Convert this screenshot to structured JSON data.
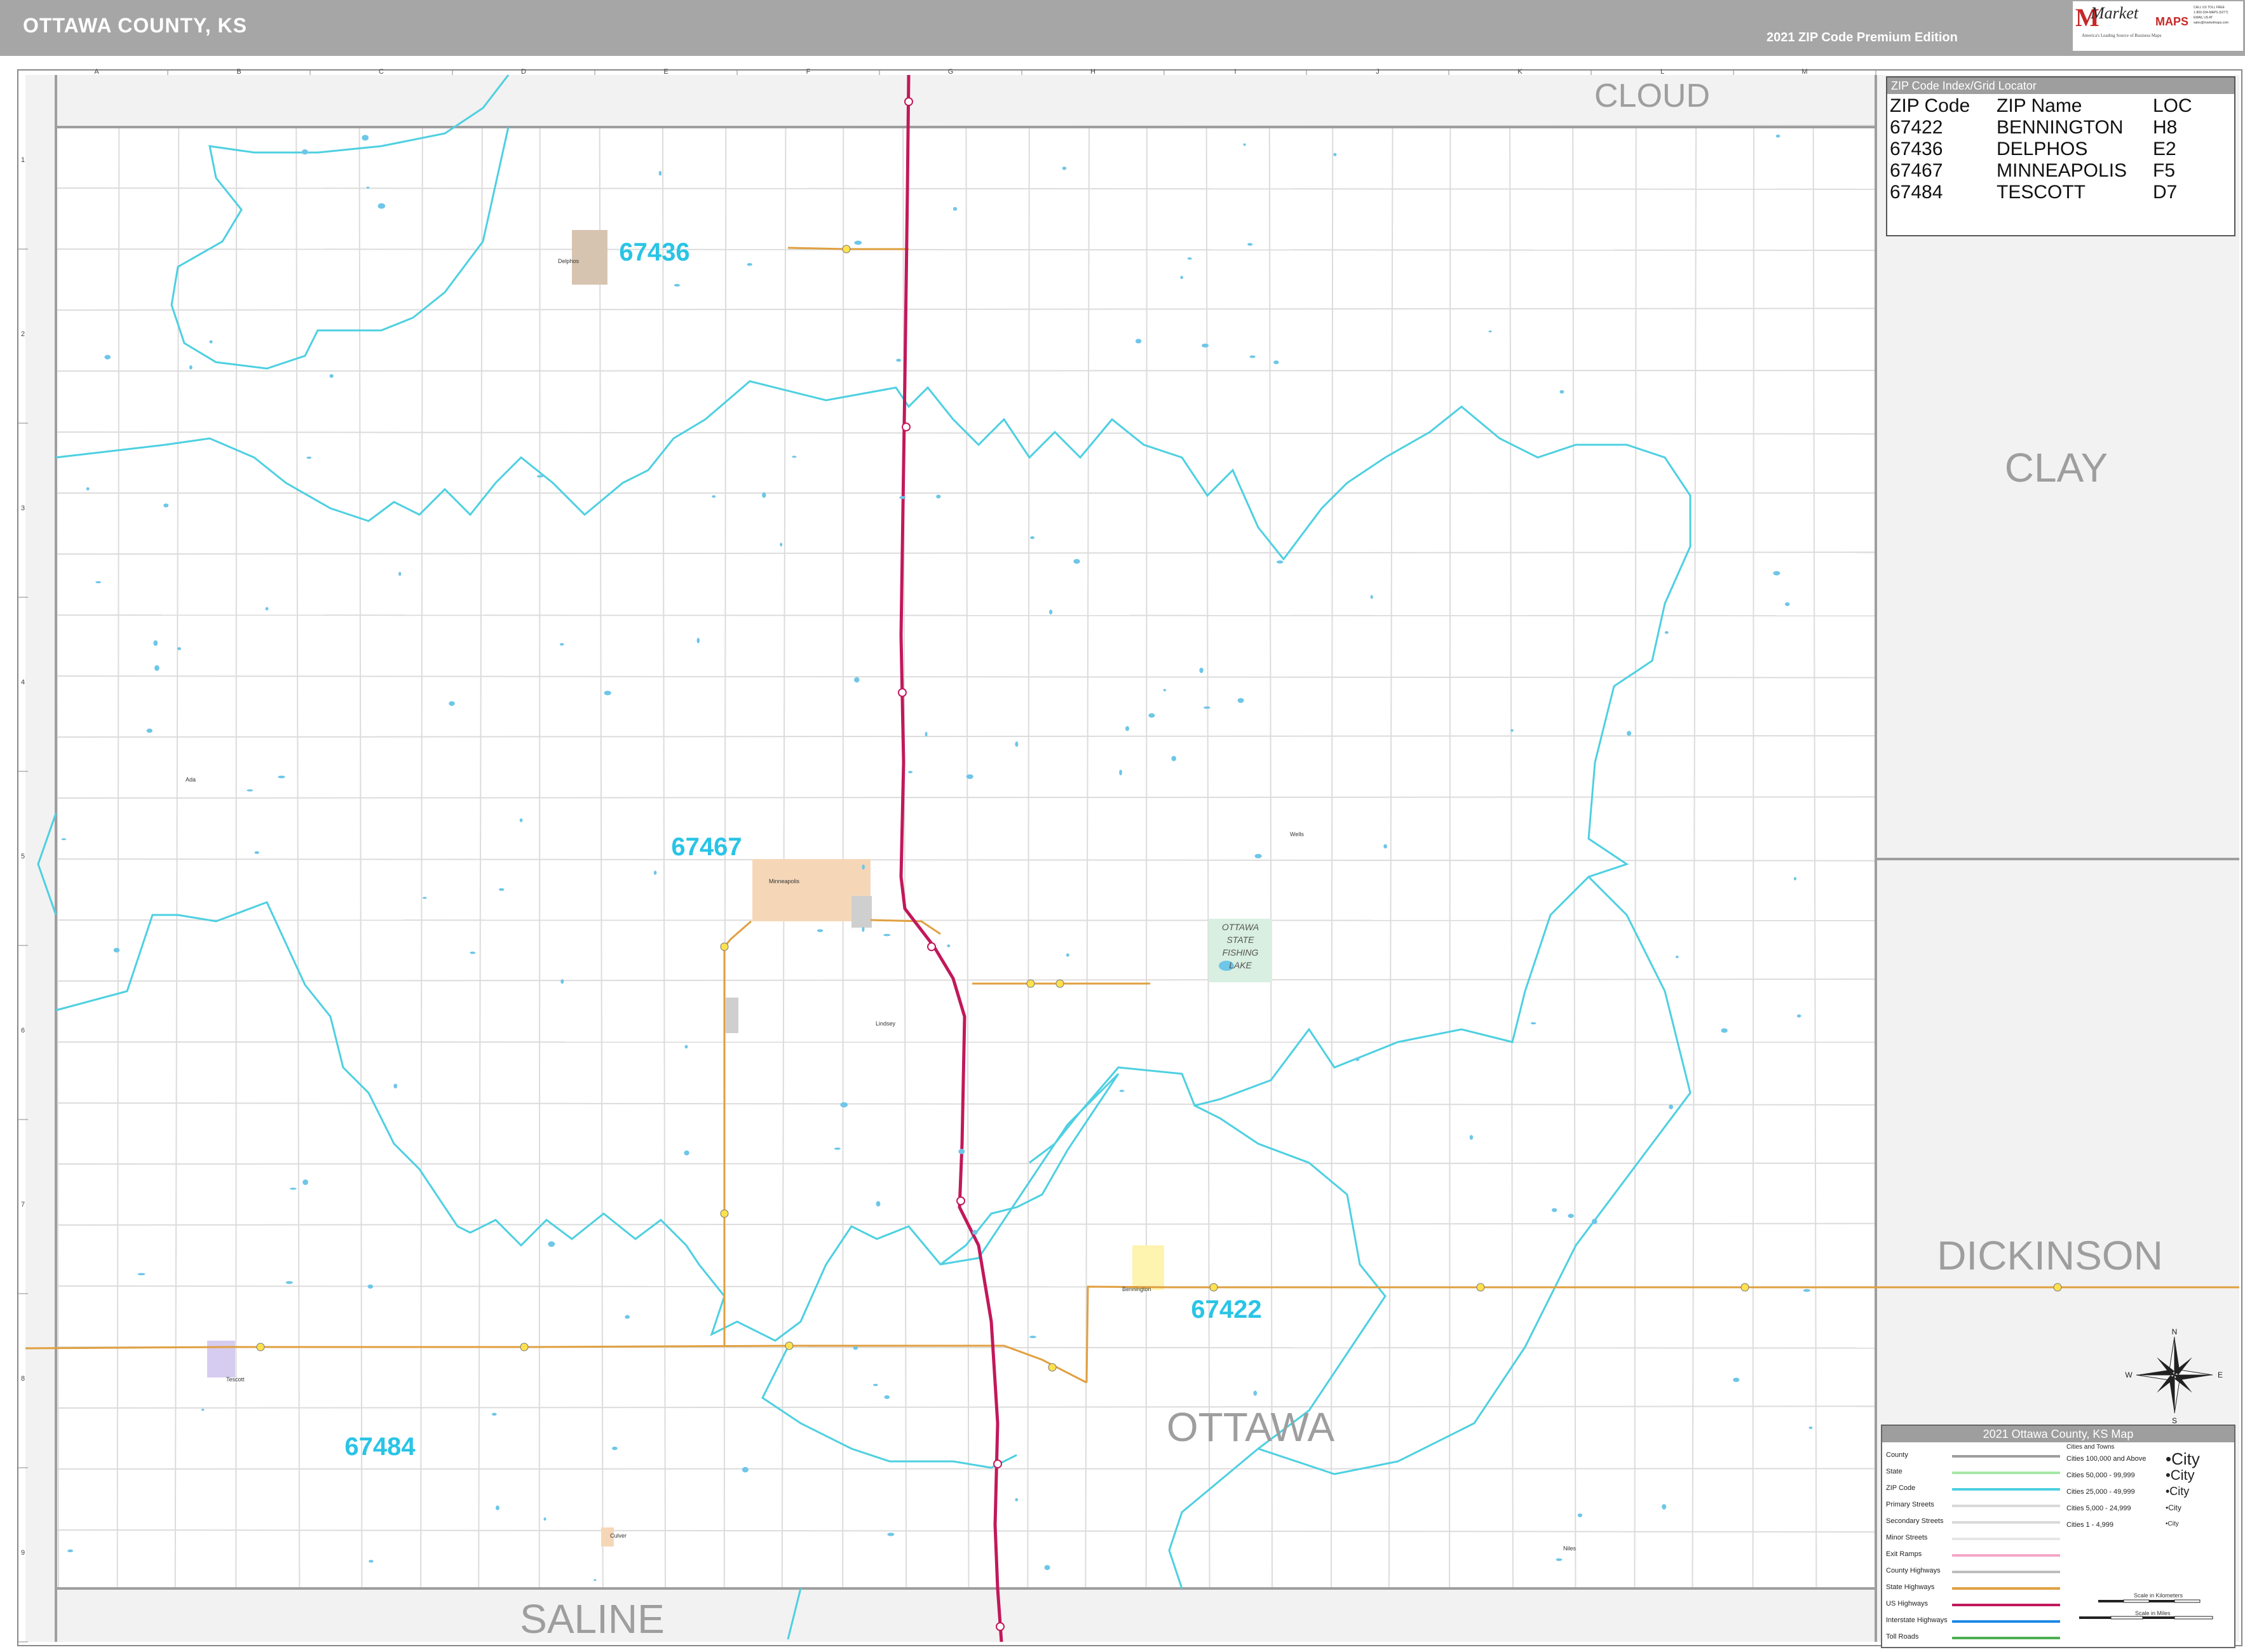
{
  "header": {
    "title": "OTTAWA COUNTY, KS",
    "edition": "2021 ZIP Code Premium Edition"
  },
  "logo": {
    "brand_top": "Market",
    "brand_bottom": "MAPS",
    "tagline": "America's Leading Source of Business Maps",
    "contact_lines": [
      "CALL US TOLL FREE",
      "1-800-334-MAPS (6277)",
      "EMAIL US AT",
      "sales@marketmaps.com"
    ]
  },
  "grid": {
    "columns": [
      "A",
      "B",
      "C",
      "D",
      "E",
      "F",
      "G",
      "H",
      "I",
      "J",
      "K",
      "L",
      "M"
    ],
    "rows": [
      "1",
      "2",
      "3",
      "4",
      "5",
      "6",
      "7",
      "8",
      "9"
    ]
  },
  "neighbor_counties": {
    "north": "CLOUD",
    "east_upper": "CLAY",
    "east_lower": "DICKINSON",
    "south": "SALINE"
  },
  "county_label": "OTTAWA",
  "zip_labels": [
    {
      "zip": "67436",
      "place": "Delphos"
    },
    {
      "zip": "67467",
      "place": "Minneapolis"
    },
    {
      "zip": "67422",
      "place": "Bennington"
    },
    {
      "zip": "67484",
      "place": "Tescott"
    }
  ],
  "place_labels": [
    "Delphos",
    "Minneapolis",
    "Bennington",
    "Tescott",
    "Ada",
    "Wells",
    "Lindsey",
    "Culver",
    "Niles"
  ],
  "lake_label": "OTTAWA STATE FISHING LAKE",
  "zip_index": {
    "title": "ZIP Code Index/Grid Locator",
    "headers": [
      "ZIP Code",
      "ZIP Name",
      "LOC"
    ],
    "rows": [
      [
        "67422",
        "BENNINGTON",
        "H8"
      ],
      [
        "67436",
        "DELPHOS",
        "E2"
      ],
      [
        "67467",
        "MINNEAPOLIS",
        "F5"
      ],
      [
        "67484",
        "TESCOTT",
        "D7"
      ]
    ]
  },
  "legend": {
    "title": "2021 Ottawa County, KS Map",
    "cities_header": "Cities and Towns",
    "items": [
      "County",
      "State",
      "ZIP Code",
      "Primary Streets",
      "Secondary Streets",
      "Minor Streets",
      "Exit Ramps",
      "County Highways",
      "State Highways",
      "US Highways",
      "Interstate Highways",
      "Toll Roads"
    ],
    "item_colors": [
      "#9e9e9e",
      "#a5e8a5",
      "#4dd0e1",
      "#d9d9d9",
      "#d9d9d9",
      "#e6e6e6",
      "#f4a6c8",
      "#bdbdbd",
      "#e0a040",
      "#c2185b",
      "#1e88e5",
      "#4caf50"
    ],
    "cities": [
      {
        "label": "Cities 100,000 and Above",
        "sample": "City"
      },
      {
        "label": "Cities 50,000 - 99,999",
        "sample": "City"
      },
      {
        "label": "Cities 25,000 - 49,999",
        "sample": "City"
      },
      {
        "label": "Cities 5,000 - 24,999",
        "sample": "City"
      },
      {
        "label": "Cities 1 - 4,999",
        "sample": "City"
      }
    ],
    "scale_km": "Scale in Kilometers",
    "scale_mi": "Scale in Miles"
  },
  "compass": [
    "N",
    "E",
    "S",
    "W"
  ],
  "colors": {
    "zip_boundary": "#4dd0e1",
    "zip_label": "#29c4e6",
    "county_boundary": "#9e9e9e",
    "outside_fill": "#f2f2f2",
    "us_highway": "#c2185b",
    "state_highway": "#e0a040",
    "city_minneapolis": "#f5d7b8",
    "city_delphos": "#d7c4b0",
    "city_bennington": "#fff3b0",
    "city_tescott": "#d6ccf0",
    "lake_fill": "#d9efe1"
  }
}
